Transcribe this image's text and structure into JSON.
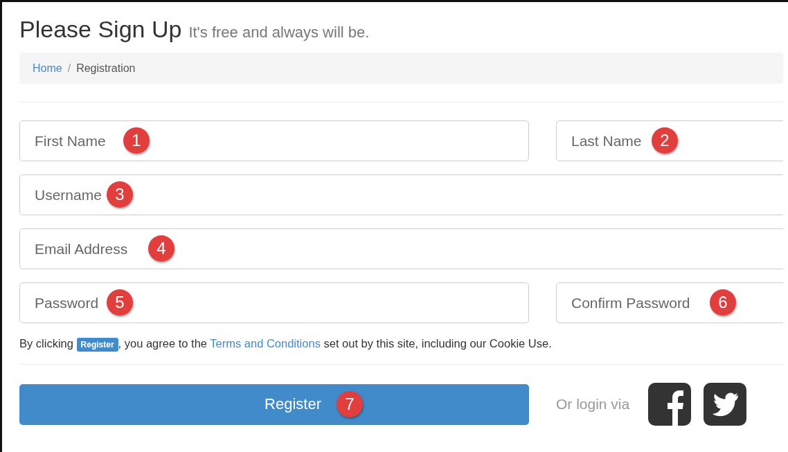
{
  "heading": {
    "title": "Please Sign Up",
    "subtitle": "It's free and always will be."
  },
  "breadcrumb_separator": "/",
  "breadcrumb": [
    {
      "label": "Home",
      "kind": "link"
    },
    {
      "label": "Registration",
      "kind": "current"
    }
  ],
  "fields": [
    [
      {
        "placeholder": "First Name",
        "badge": "1"
      },
      {
        "placeholder": "Last Name",
        "badge": "2"
      }
    ],
    [
      {
        "placeholder": "Username",
        "badge": "3"
      }
    ],
    [
      {
        "placeholder": "Email Address",
        "badge": "4"
      }
    ],
    [
      {
        "placeholder": "Password",
        "badge": "5"
      },
      {
        "placeholder": "Confirm Password",
        "badge": "6"
      }
    ]
  ],
  "terms": {
    "before": "By clicking",
    "label": "Register",
    "middle": ", you agree to the",
    "link": "Terms and Conditions",
    "after": "set out by this site, including our Cookie Use."
  },
  "register_button": {
    "label": "Register",
    "badge": "7"
  },
  "social": {
    "text": "Or login via",
    "icons": [
      {
        "kind": "facebook"
      },
      {
        "kind": "twitter"
      }
    ]
  }
}
